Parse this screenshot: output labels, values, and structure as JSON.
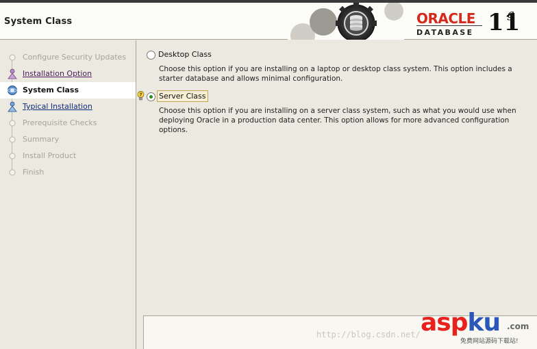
{
  "header": {
    "title": "System Class",
    "logo": {
      "brand": "ORACLE",
      "product": "DATABASE",
      "version": "11",
      "version_suffix": "g"
    }
  },
  "sidebar": {
    "steps": [
      {
        "label": "Configure Security Updates",
        "state": "done-disabled"
      },
      {
        "label": "Installation Option",
        "state": "done"
      },
      {
        "label": "System Class",
        "state": "current"
      },
      {
        "label": "Typical Installation",
        "state": "next"
      },
      {
        "label": "Prerequisite Checks",
        "state": "pending"
      },
      {
        "label": "Summary",
        "state": "pending"
      },
      {
        "label": "Install Product",
        "state": "pending"
      },
      {
        "label": "Finish",
        "state": "pending"
      }
    ]
  },
  "main": {
    "options": [
      {
        "label": "Desktop Class",
        "checked": false,
        "description": "Choose this option if you are installing on a laptop or desktop class system. This option includes a starter database and allows minimal configuration."
      },
      {
        "label": "Server Class",
        "checked": true,
        "description": "Choose this option if you are installing on a server class system, such as what you would use when deploying Oracle in a production data center. This option allows for more advanced configuration options."
      }
    ]
  },
  "watermark": {
    "url": "http://blog.csdn.net/",
    "site_a": "asp",
    "site_b": "ku",
    "site_tld": ".com",
    "site_slogan": "免费网站源码下载站!"
  },
  "colors": {
    "oracle_red": "#d42a1e",
    "radio_green": "#2d8a2a",
    "done_step": "#4a1a5c",
    "next_step": "#0d2a7a"
  }
}
